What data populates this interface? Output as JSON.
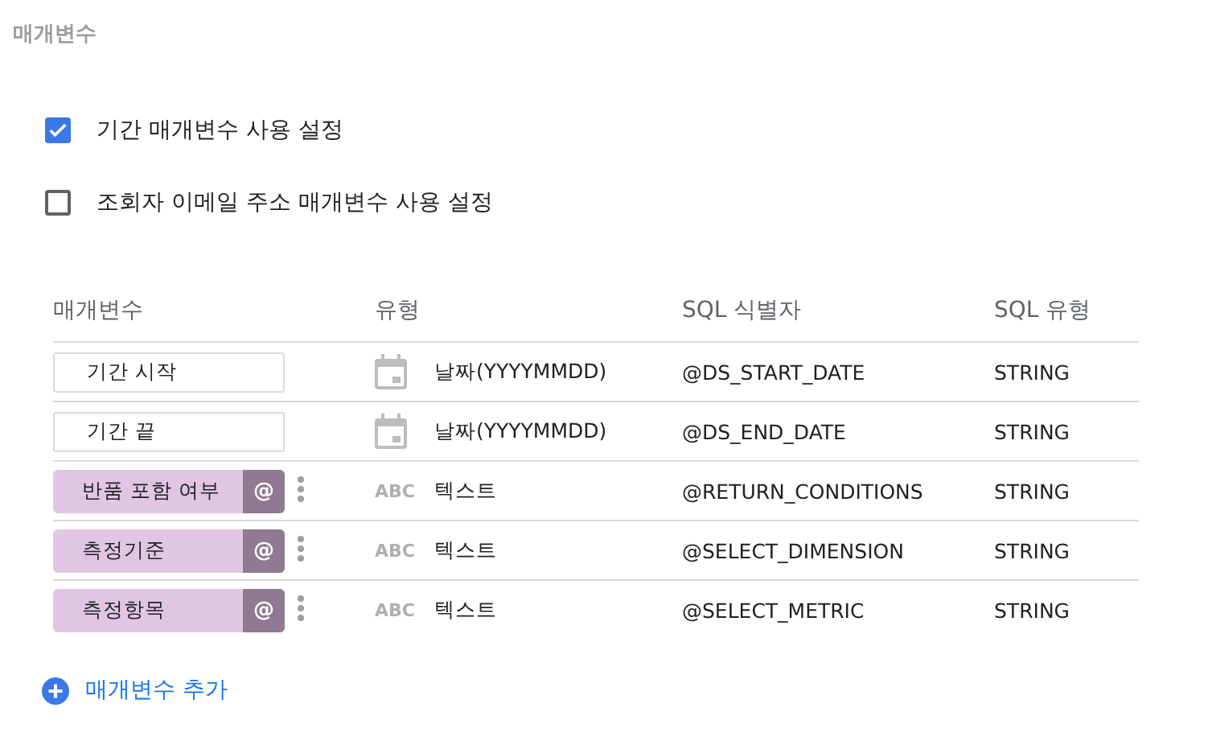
{
  "section_title": "매개변수",
  "options": [
    {
      "label": "기간 매개변수 사용 설정",
      "checked": true
    },
    {
      "label": "조회자 이메일 주소 매개변수 사용 설정",
      "checked": false
    }
  ],
  "table": {
    "columns": [
      "매개변수",
      "유형",
      "SQL 식별자",
      "SQL 유형"
    ],
    "rows": [
      {
        "kind": "date",
        "name": "기간 시작",
        "type": "날짜(YYYYMMDD)",
        "sql_id": "@DS_START_DATE",
        "sql_type": "STRING"
      },
      {
        "kind": "date",
        "name": "기간 끝",
        "type": "날짜(YYYYMMDD)",
        "sql_id": "@DS_END_DATE",
        "sql_type": "STRING"
      },
      {
        "kind": "text",
        "name": "반품 포함 여부",
        "badge": "@",
        "type_glyph": "ABC",
        "type": "텍스트",
        "sql_id": "@RETURN_CONDITIONS",
        "sql_type": "STRING"
      },
      {
        "kind": "text",
        "name": "측정기준",
        "badge": "@",
        "type_glyph": "ABC",
        "type": "텍스트",
        "sql_id": "@SELECT_DIMENSION",
        "sql_type": "STRING"
      },
      {
        "kind": "text",
        "name": "측정항목",
        "badge": "@",
        "type_glyph": "ABC",
        "type": "텍스트",
        "sql_id": "@SELECT_METRIC",
        "sql_type": "STRING"
      }
    ]
  },
  "add_button": "매개변수 추가"
}
